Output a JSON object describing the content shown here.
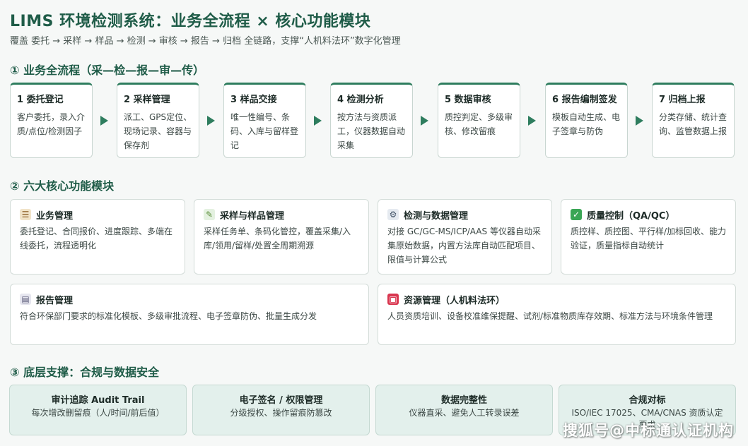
{
  "header": {
    "title": "LIMS 环境检测系统：业务全流程 × 核心功能模块",
    "subtitle": "覆盖 委托 → 采样 → 样品 → 检测 → 审核 → 报告 → 归档 全链路，支撑“人机料法环”数字化管理"
  },
  "sections": {
    "flow": "① 业务全流程（采—检—报—审—传）",
    "modules": "② 六大核心功能模块",
    "support": "③ 底层支撑：合规与数据安全"
  },
  "flow_steps": [
    {
      "title": "1 委托登记",
      "desc": "客户委托，录入介质/点位/检测因子"
    },
    {
      "title": "2 采样管理",
      "desc": "派工、GPS定位、现场记录、容器与保存剂"
    },
    {
      "title": "3 样品交接",
      "desc": "唯一性编号、条码、入库与留样登记"
    },
    {
      "title": "4 检测分析",
      "desc": "按方法与资质派工，仪器数据自动采集"
    },
    {
      "title": "5 数据审核",
      "desc": "质控判定、多级审核、修改留痕"
    },
    {
      "title": "6 报告编制签发",
      "desc": "模板自动生成、电子签章与防伪"
    },
    {
      "title": "7 归档上报",
      "desc": "分类存储、统计查询、监管数据上报"
    }
  ],
  "modules": [
    {
      "icon": "clipboard-icon",
      "title": "业务管理",
      "desc": "委托登记、合同报价、进度跟踪、多端在线委托，流程透明化"
    },
    {
      "icon": "test-tube-icon",
      "title": "采样与样品管理",
      "desc": "采样任务单、条码化管控，覆盖采集/入库/领用/留样/处置全周期溯源"
    },
    {
      "icon": "microscope-icon",
      "title": "检测与数据管理",
      "desc": "对接 GC/GC-MS/ICP/AAS 等仪器自动采集原始数据，内置方法库自动匹配项目、限值与计算公式"
    },
    {
      "icon": "check-mark-icon",
      "title": "质量控制（QA/QC）",
      "desc": "质控样、质控图、平行样/加标回收、能力验证，质量指标自动统计"
    },
    {
      "icon": "document-icon",
      "title": "报告管理",
      "desc": "符合环保部门要求的标准化模板、多级审批流程、电子签章防伪、批量生成分发"
    },
    {
      "icon": "toolbox-icon",
      "title": "资源管理（人机料法环）",
      "desc": "人员资质培训、设备校准维保提醒、试剂/标准物质库存效期、标准方法与环境条件管理"
    }
  ],
  "support": [
    {
      "title": "审计追踪 Audit Trail",
      "desc": "每次增改删留痕（人/时间/前后值）"
    },
    {
      "title": "电子签名 / 权限管理",
      "desc": "分级授权、操作留痕防篡改"
    },
    {
      "title": "数据完整性",
      "desc": "仪器直采、避免人工转录误差"
    },
    {
      "title": "合规对标",
      "desc": "ISO/IEC 17025、CMA/CNAS 资质认定要求"
    }
  ],
  "watermark": "搜狐号@中标通认证机构",
  "colors": {
    "accent": "#2e7d5e",
    "title": "#1f5c48",
    "support_bg": "#e3f0ec"
  }
}
